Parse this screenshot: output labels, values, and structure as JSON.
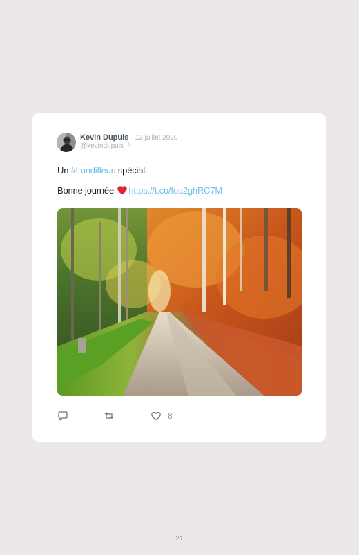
{
  "tweet": {
    "author_name": "Kevin Dupuis",
    "separator": "·",
    "date": "13 juillet 2020",
    "handle": "@kevindupuis_fr",
    "line1_prefix": "Un ",
    "hashtag": "#Lundifleuri",
    "line1_suffix": " spécial.",
    "line2_prefix": "Bonne journée",
    "link": "https://t.co/foa2ghRC7M",
    "like_count": "8"
  },
  "icons": {
    "reply": "reply-icon",
    "retweet": "retweet-icon",
    "like": "heart-outline-icon",
    "emoji": "red-heart-emoji-icon"
  },
  "colors": {
    "background": "#ede8e8",
    "card": "#ffffff",
    "link": "#6fc0ea",
    "heart_emoji": "#e0243a"
  },
  "page": {
    "number": "21"
  }
}
